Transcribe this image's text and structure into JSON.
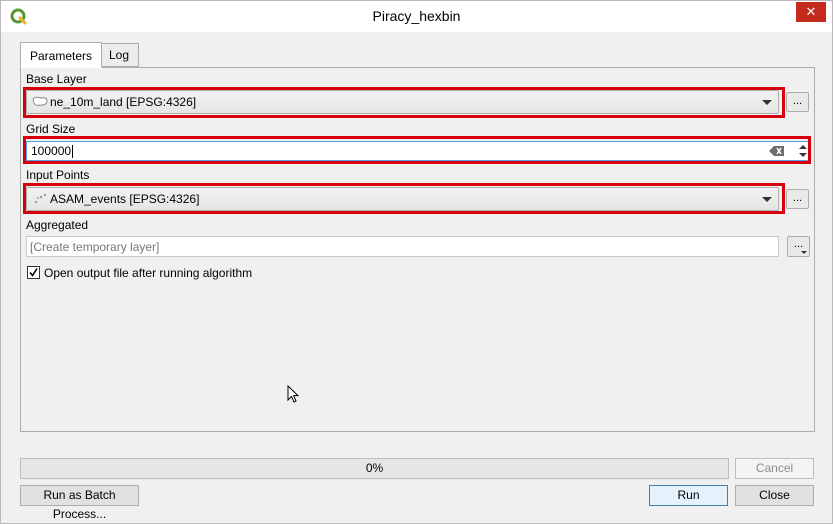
{
  "window": {
    "title": "Piracy_hexbin",
    "close_label": "✕"
  },
  "tabs": [
    {
      "label": "Parameters",
      "active": true
    },
    {
      "label": "Log",
      "active": false
    }
  ],
  "params": {
    "base_layer": {
      "label": "Base Layer",
      "value": "ne_10m_land [EPSG:4326]",
      "browse": "..."
    },
    "grid_size": {
      "label": "Grid Size",
      "value": "100000"
    },
    "input_points": {
      "label": "Input Points",
      "value": "ASAM_events [EPSG:4326]",
      "browse": "..."
    },
    "aggregated": {
      "label": "Aggregated",
      "placeholder": "[Create temporary layer]",
      "browse": "..."
    },
    "open_output": {
      "label": "Open output file after running algorithm",
      "checked": true
    }
  },
  "progress": {
    "text": "0%",
    "value": 0
  },
  "buttons": {
    "cancel": "Cancel",
    "batch": "Run as Batch Process...",
    "run": "Run",
    "close": "Close"
  },
  "colors": {
    "highlight": "#d9000d",
    "focus": "#569de5",
    "qgis_green": "#589632"
  },
  "icons": {
    "app": "qgis-logo-icon",
    "base_layer": "polygon-layer-icon",
    "input_points": "point-layer-icon",
    "clear": "clear-text-icon",
    "spin": "spinbox-arrows-icon",
    "cursor": "mouse-pointer-icon"
  }
}
